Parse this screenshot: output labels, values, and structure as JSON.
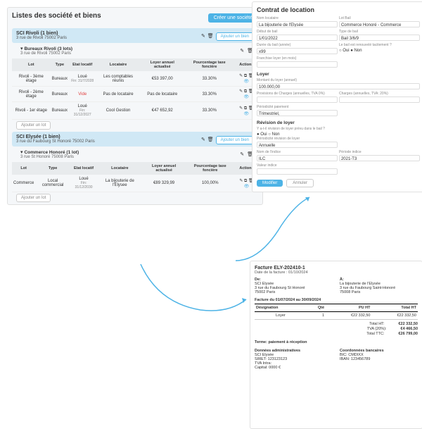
{
  "leftTitle": "Listes des société et biens",
  "createBtn": "Créer une société",
  "addBien": "Ajouter un bien",
  "addLot": "Ajouter un lot",
  "soc1": {
    "title": "SCI Rivoli (1 bien)",
    "addr": "3 rue de Rivoli 75002 Paris"
  },
  "bld1": {
    "title": "Bureaux Rivoli (3 lots)",
    "addr": "3 rue de Rivoli 75002 Paris"
  },
  "thead": {
    "lot": "Lot",
    "type": "Type",
    "etat": "Etat locatif",
    "loc": "Locataire",
    "loyer": "Loyer annuel actualisé",
    "pct": "Pourcentage taxe foncière",
    "act": "Actions"
  },
  "rows1": [
    {
      "lot": "Rivoli - 3ème étage",
      "type": "Bureaux",
      "etat": "Loué",
      "fin": "Fin: 31/7/2028",
      "loc": "Les comptables réunis",
      "loyer": "€53 397,00",
      "pct": "33.30%"
    },
    {
      "lot": "Rivoli - 2ème étage",
      "type": "Bureaux",
      "etat": "Vide",
      "fin": "",
      "loc": "Pas de locataire",
      "loyer": "Pas de locataire",
      "pct": "33.30%"
    },
    {
      "lot": "Rivoli - 1er étage",
      "type": "Bureaux",
      "etat": "Loué",
      "fin": "Fin: 31/12/2027",
      "loc": "Cool Gestion",
      "loyer": "€47 652,92",
      "pct": "33.30%"
    }
  ],
  "soc2": {
    "title": "SCI Elysée (1 bien)",
    "addr": "3 rue du Faubourg St Honoré 75002 Paris"
  },
  "bld2": {
    "title": "Commerce Honoré (1 lot)",
    "addr": "3 rue St Honoré 75008 Paris"
  },
  "rows2": [
    {
      "lot": "Commerce",
      "type": "Local commercial",
      "etat": "Loué",
      "fin": "Fin: 31/12/2030",
      "loc": "La bijouterie de l'Elysee",
      "loyer": "€89 329,99",
      "pct": "100,00%"
    }
  ],
  "form": {
    "title": "Contrat de location",
    "nomLoc": {
      "lab": "Nom locataire",
      "val": "La bijouterie de l'Elysée"
    },
    "lotBail": {
      "lab": "Lot Bail",
      "val": "Commerce Honoré - Commerce"
    },
    "debut": {
      "lab": "Début de bail",
      "val": "1/01/2022"
    },
    "type": {
      "lab": "Type de bail",
      "val": "Bail 3/6/9"
    },
    "duree": {
      "lab": "Durée du bail (année)",
      "val": "x99"
    },
    "renouv": {
      "lab": "Le bail est renouvelé tacitement ?",
      "oui": "Oui",
      "non": "Non"
    },
    "franch": {
      "lab": "Franchise loyer   (en mois)",
      "val": ""
    },
    "loyerSec": "Loyer",
    "montant": {
      "lab": "Montant du loyer (annuel)",
      "val": "100.000,00"
    },
    "prov": {
      "lab": "Provisions de Charges (annuelles, TVA 0%)",
      "val": ""
    },
    "charges": {
      "lab": "Charges (annuelles, TVA: 20%)",
      "val": ""
    },
    "period": {
      "lab": "Périodicité paiement",
      "val": "Trimestriel,"
    },
    "revSec": "Révision de loyer",
    "rev": {
      "lab": "Y a-t-il révision de loyer prévu dans le bail ?",
      "oui": "Oui",
      "non": "Non"
    },
    "periodRev": {
      "lab": "Périodicité révision de loyer",
      "val": "Annuelle"
    },
    "nomIdx": {
      "lab": "Nom de l'indice",
      "val": "ILC"
    },
    "periodIdx": {
      "lab": "Période indice",
      "val": "2021-T3"
    },
    "valIdx": {
      "lab": "Valeur indice",
      "val": ""
    },
    "btnMod": "Modifier",
    "btnAnn": "Annuler"
  },
  "inv": {
    "num": "Facture ELY-202410-1",
    "date": "Date de la facture : 01/10/2024",
    "deLab": "De:",
    "de": [
      "SCI Elysée",
      "3 rue du Faubourg St Honoré",
      "75002 Paris"
    ],
    "aLab": "À:",
    "a": [
      "La bijouterie de l'Elysée",
      "3 rue du Faubourg Saint-Honoré",
      "75008 Paris"
    ],
    "period": "Facture du 01/07/2024 au 30/09/2024",
    "th": {
      "des": "Désignation",
      "qte": "Qté",
      "pu": "PU HT",
      "tot": "Total HT"
    },
    "line": {
      "des": "Loyer",
      "qte": "1",
      "pu": "€22 332,50",
      "tot": "€22 332,50"
    },
    "totHT": {
      "lab": "Total HT:",
      "val": "€22 332,50"
    },
    "tva": {
      "lab": "TVA (20%):",
      "val": "€4 466,50"
    },
    "totTTC": {
      "lab": "Total TTC:",
      "val": "€26 799,00"
    },
    "terme": "Terme: paiement à réception",
    "adminLab": "Données administratives",
    "admin": [
      "SCI Elysée",
      "SIRET: 123123123",
      "TVA Intra:",
      "Capital: 0000 €"
    ],
    "bankLab": "Coordonnées bancaires",
    "bank": [
      "BIC: CMDIXX",
      "IBAN: 123456789"
    ]
  }
}
